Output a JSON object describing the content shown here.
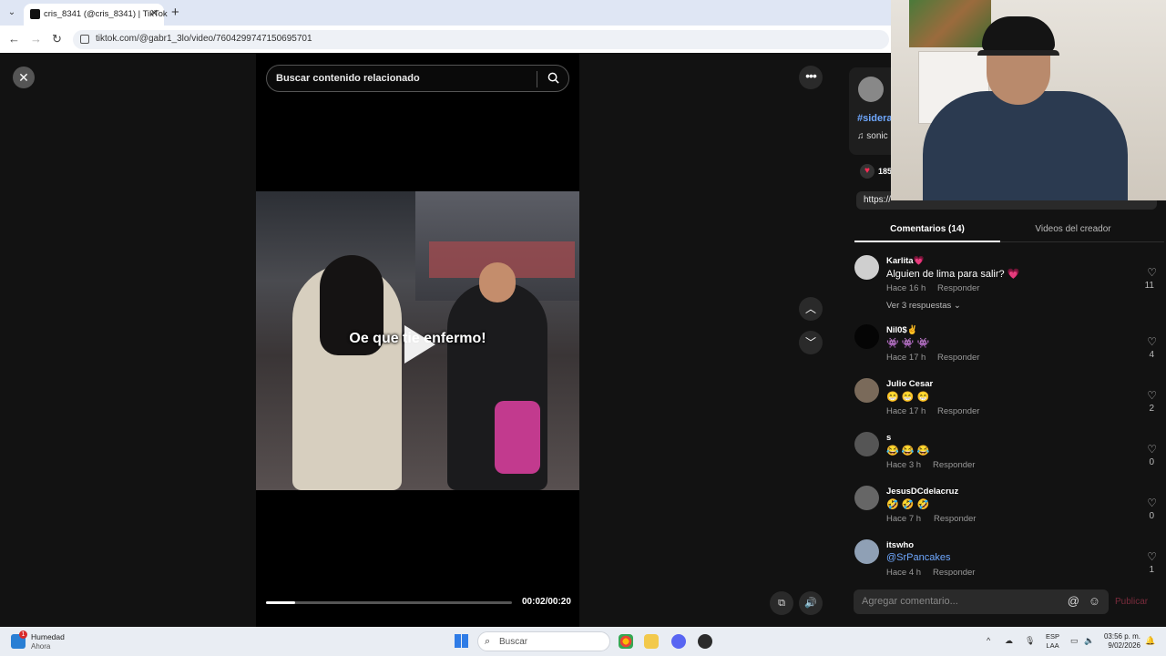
{
  "browser": {
    "tab_title": "cris_8341 (@cris_8341) | TikTok",
    "tab_close": "✕",
    "new_tab": "+",
    "url": "tiktok.com/@gabr1_3lo/video/7604299747150695701",
    "back": "←",
    "forward": "→",
    "reload": "↻",
    "tab_search": "⌄"
  },
  "player": {
    "close": "✕",
    "search_placeholder": "Buscar contenido relacionado",
    "caption": "Oe que tie      enfermo!",
    "time": "00:02/00:20",
    "progress_fraction": 0.12,
    "more": "•••",
    "prev": "︿",
    "next": "﹀",
    "pip": "⧉",
    "volume": "🔊"
  },
  "info": {
    "hashtag": "#sidera",
    "music": "♫  sonic",
    "likes": "185",
    "link": "https://"
  },
  "tabs": {
    "comments": "Comentarios (14)",
    "creator_videos": "Videos del creador"
  },
  "comments": [
    {
      "user": "Karlita💗",
      "text": "Alguien de lima para salir? 💗",
      "time": "Hace 16 h",
      "reply": "Responder",
      "likes": "11",
      "see_replies": "Ver 3 respuestas ⌄",
      "avatar_color": "#cfcfcf"
    },
    {
      "user": "Nil0$✌",
      "text": "👾 👾 👾",
      "time": "Hace 17 h",
      "reply": "Responder",
      "likes": "4",
      "avatar_color": "#0a0a0a"
    },
    {
      "user": "Julio Cesar",
      "text": "😁 😁 😁",
      "time": "Hace 17 h",
      "reply": "Responder",
      "likes": "2",
      "avatar_color": "#7a6a5a"
    },
    {
      "user": "s",
      "text": "😂 😂 😂",
      "time": "Hace 3 h",
      "reply": "Responder",
      "likes": "0",
      "avatar_color": "#555"
    },
    {
      "user": "JesusDCdelacruz",
      "text": "🤣 🤣 🤣",
      "time": "Hace 7 h",
      "reply": "Responder",
      "likes": "0",
      "avatar_color": "#666"
    },
    {
      "user": "itswho",
      "text": "@SrPancakes",
      "time": "Hace 4 h",
      "reply": "Responder",
      "likes": "1",
      "avatar_color": "#8fa0b5"
    }
  ],
  "comment_box": {
    "placeholder": "Agregar comentario...",
    "at": "@",
    "emoji": "☺",
    "publish": "Publicar"
  },
  "taskbar": {
    "weather_title": "Humedad",
    "weather_sub": "Ahora",
    "weather_badge": "1",
    "search": "Buscar",
    "lang_top": "ESP",
    "lang_bottom": "LAA",
    "time": "03:56 p. m.",
    "date": "9/02/2026",
    "tray_up": "^"
  },
  "colors": {
    "accent_red": "#fe2c55",
    "link_blue": "#6fa8ff"
  }
}
